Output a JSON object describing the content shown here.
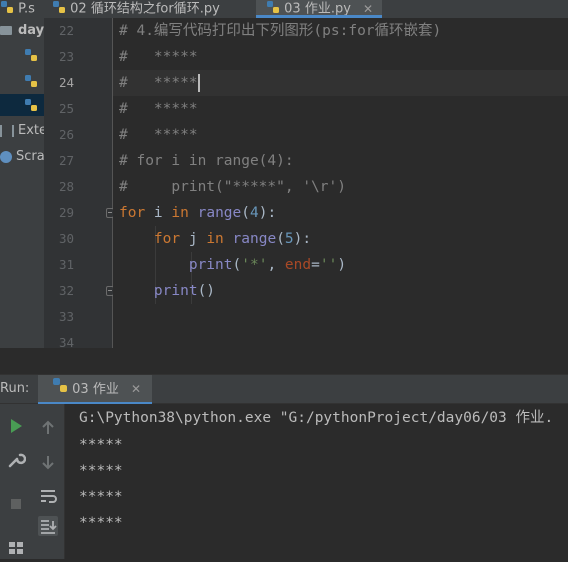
{
  "tabs": [
    {
      "label": "P.s",
      "active": false
    },
    {
      "label": "02 循环结构之for循环.py",
      "active": false
    },
    {
      "label": "03 作业.py",
      "active": true
    }
  ],
  "sidebar": {
    "items": [
      {
        "label": "day"
      },
      {
        "label": ""
      },
      {
        "label": ""
      },
      {
        "label": ""
      },
      {
        "label": "Exte"
      },
      {
        "label": "Scra"
      }
    ]
  },
  "editor": {
    "line_numbers": [
      "22",
      "23",
      "24",
      "25",
      "26",
      "27",
      "28",
      "29",
      "30",
      "31",
      "32",
      "33",
      "34"
    ],
    "current_line": "24",
    "lines": {
      "l22": "# 4.编写代码打印出下列图形(ps:for循环嵌套)",
      "l23": "#   *****",
      "l24": "#   *****",
      "l25": "#   *****",
      "l26": "#   *****",
      "l27": "# for i in range(4):",
      "l28": "#     print(\"*****\", '\\r')",
      "l29_kw1": "for",
      "l29_var": " i ",
      "l29_kw2": "in",
      "l29_fn": "range",
      "l29_arg": "4",
      "l30_kw1": "for",
      "l30_var": " j ",
      "l30_kw2": "in",
      "l30_fn": "range",
      "l30_arg": "5",
      "l31_fn": "print",
      "l31_str": "'*'",
      "l31_kwarg": "end",
      "l31_str2": "''",
      "l32_fn": "print"
    }
  },
  "run_panel": {
    "label": "Run:",
    "tab_label": "03 作业",
    "console": [
      "G:\\Python38\\python.exe \"G:/pythonProject/day06/03 作业.",
      "*****",
      "*****",
      "*****",
      "*****"
    ]
  },
  "colors": {
    "background": "#2b2b2b",
    "keyword": "#cc7832",
    "builtin": "#8888c6",
    "number": "#6897bb",
    "string": "#6a8759",
    "comment": "#808080",
    "accent": "#4a88c7"
  }
}
